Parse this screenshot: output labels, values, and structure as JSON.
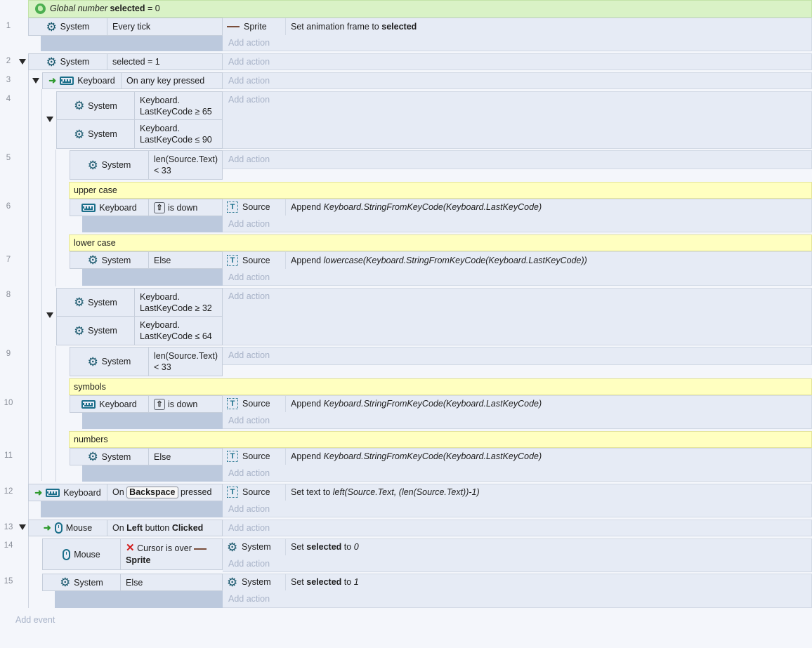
{
  "global_var": {
    "prefix": "Global number",
    "name": "selected",
    "suffix": "= 0"
  },
  "common": {
    "add_action": "Add action",
    "add_event": "Add event",
    "system": "System",
    "keyboard": "Keyboard",
    "mouse": "Mouse",
    "source": "Source",
    "sprite": "Sprite",
    "else": "Else",
    "is_down": "is down"
  },
  "events": {
    "e1": {
      "line": "1",
      "cond": "Every tick",
      "action_obj": "Sprite",
      "action_pre": "Set animation frame to",
      "action_bold": "selected"
    },
    "e2": {
      "line": "2",
      "cond": "selected = 1"
    },
    "e3": {
      "line": "3",
      "cond": "On any key pressed"
    },
    "e4": {
      "line": "4",
      "cond1": "Keyboard.\nLastKeyCode ≥ 65",
      "cond2": "Keyboard.\nLastKeyCode ≤ 90"
    },
    "e5": {
      "line": "5",
      "cond": "len(Source.Text)\n< 33"
    },
    "e6": {
      "line": "6",
      "comment": "upper case",
      "action_pre": "Append",
      "action_expr": "Keyboard.StringFromKeyCode(Keyboard.LastKeyCode)"
    },
    "e7": {
      "line": "7",
      "comment": "lower case",
      "action_pre": "Append",
      "action_expr": "lowercase(Keyboard.StringFromKeyCode(Keyboard.LastKeyCode))"
    },
    "e8": {
      "line": "8",
      "cond1": "Keyboard.\nLastKeyCode ≥ 32",
      "cond2": "Keyboard.\nLastKeyCode ≤ 64"
    },
    "e9": {
      "line": "9",
      "cond": "len(Source.Text)\n< 33"
    },
    "e10": {
      "line": "10",
      "comment": "symbols",
      "action_pre": "Append",
      "action_expr": "Keyboard.StringFromKeyCode(Keyboard.LastKeyCode)"
    },
    "e11": {
      "line": "11",
      "comment": "numbers",
      "action_pre": "Append",
      "action_expr": "Keyboard.StringFromKeyCode(Keyboard.LastKeyCode)"
    },
    "e12": {
      "line": "12",
      "cond_pre": "On",
      "cond_key": "Backspace",
      "cond_post": "pressed",
      "action_pre": "Set text to",
      "action_expr": "left(Source.Text, (len(Source.Text))-1)"
    },
    "e13": {
      "line": "13",
      "cond_pre": "On",
      "cond_b1": "Left",
      "cond_mid": "button",
      "cond_b2": "Clicked"
    },
    "e14": {
      "line": "14",
      "cond_pre": "Cursor is over",
      "cond_obj": "Sprite",
      "action_pre": "Set",
      "action_bold": "selected",
      "action_mid": "to",
      "action_val": "0"
    },
    "e15": {
      "line": "15",
      "action_pre": "Set",
      "action_bold": "selected",
      "action_mid": "to",
      "action_val": "1"
    }
  }
}
